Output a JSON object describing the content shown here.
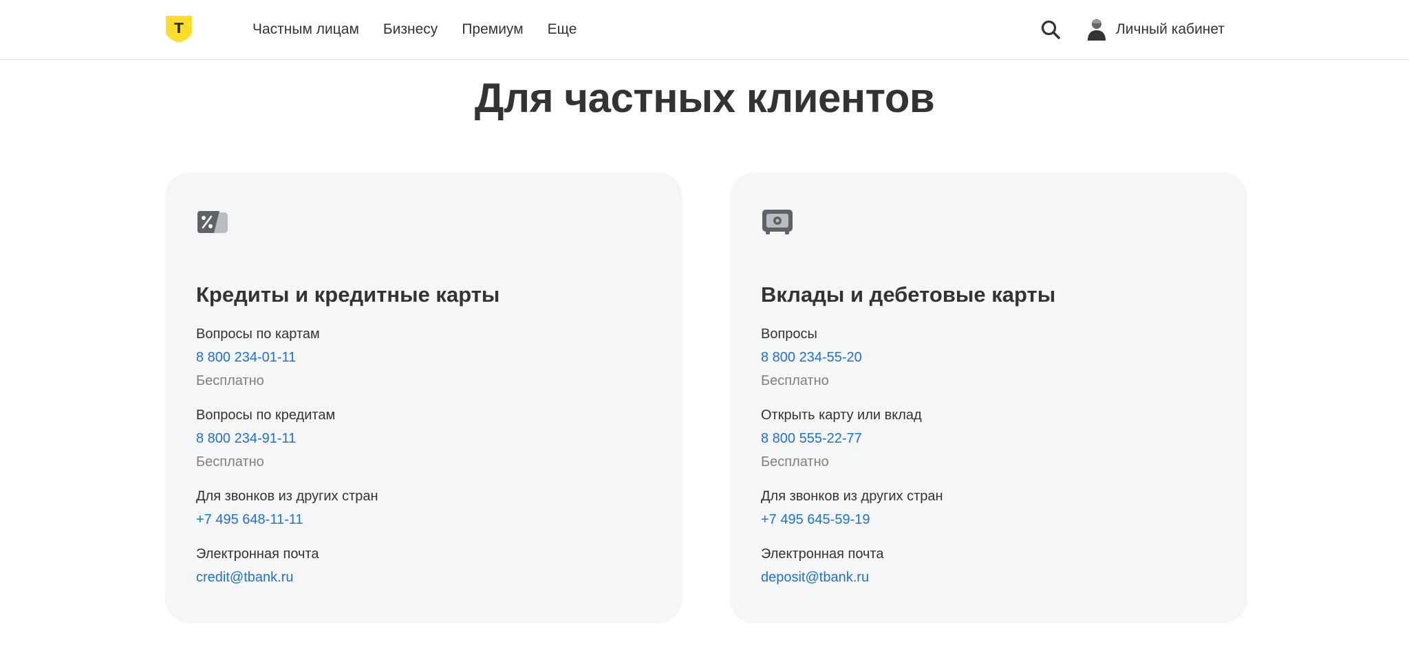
{
  "header": {
    "logo_letter": "Т",
    "nav": [
      {
        "label": "Частным лицам"
      },
      {
        "label": "Бизнесу"
      },
      {
        "label": "Премиум"
      },
      {
        "label": "Еще"
      }
    ],
    "account_label": "Личный кабинет"
  },
  "page_title": "Для частных клиентов",
  "cards": [
    {
      "title": "Кредиты и кредитные карты",
      "icon": "percent-card-icon",
      "groups": [
        {
          "label": "Вопросы по картам",
          "phone": "8 800 234-01-11",
          "note": "Бесплатно"
        },
        {
          "label": "Вопросы по кредитам",
          "phone": "8 800 234-91-11",
          "note": "Бесплатно"
        },
        {
          "label": "Для звонков из других стран",
          "phone": "+7 495 648-11-11"
        },
        {
          "label": "Электронная почта",
          "email": "credit@tbank.ru"
        }
      ]
    },
    {
      "title": "Вклады и дебетовые карты",
      "icon": "safe-icon",
      "groups": [
        {
          "label": "Вопросы",
          "phone": "8 800 234-55-20",
          "note": "Бесплатно"
        },
        {
          "label": "Открыть карту или вклад",
          "phone": "8 800 555-22-77",
          "note": "Бесплатно"
        },
        {
          "label": "Для звонков из других стран",
          "phone": "+7 495 645-59-19"
        },
        {
          "label": "Электронная почта",
          "email": "deposit@tbank.ru"
        }
      ]
    }
  ],
  "colors": {
    "brand_yellow": "#ffdd2d",
    "link_blue": "#1e6fe0",
    "card_bg": "#f5f6f8",
    "text": "#333333",
    "muted": "#808080"
  }
}
